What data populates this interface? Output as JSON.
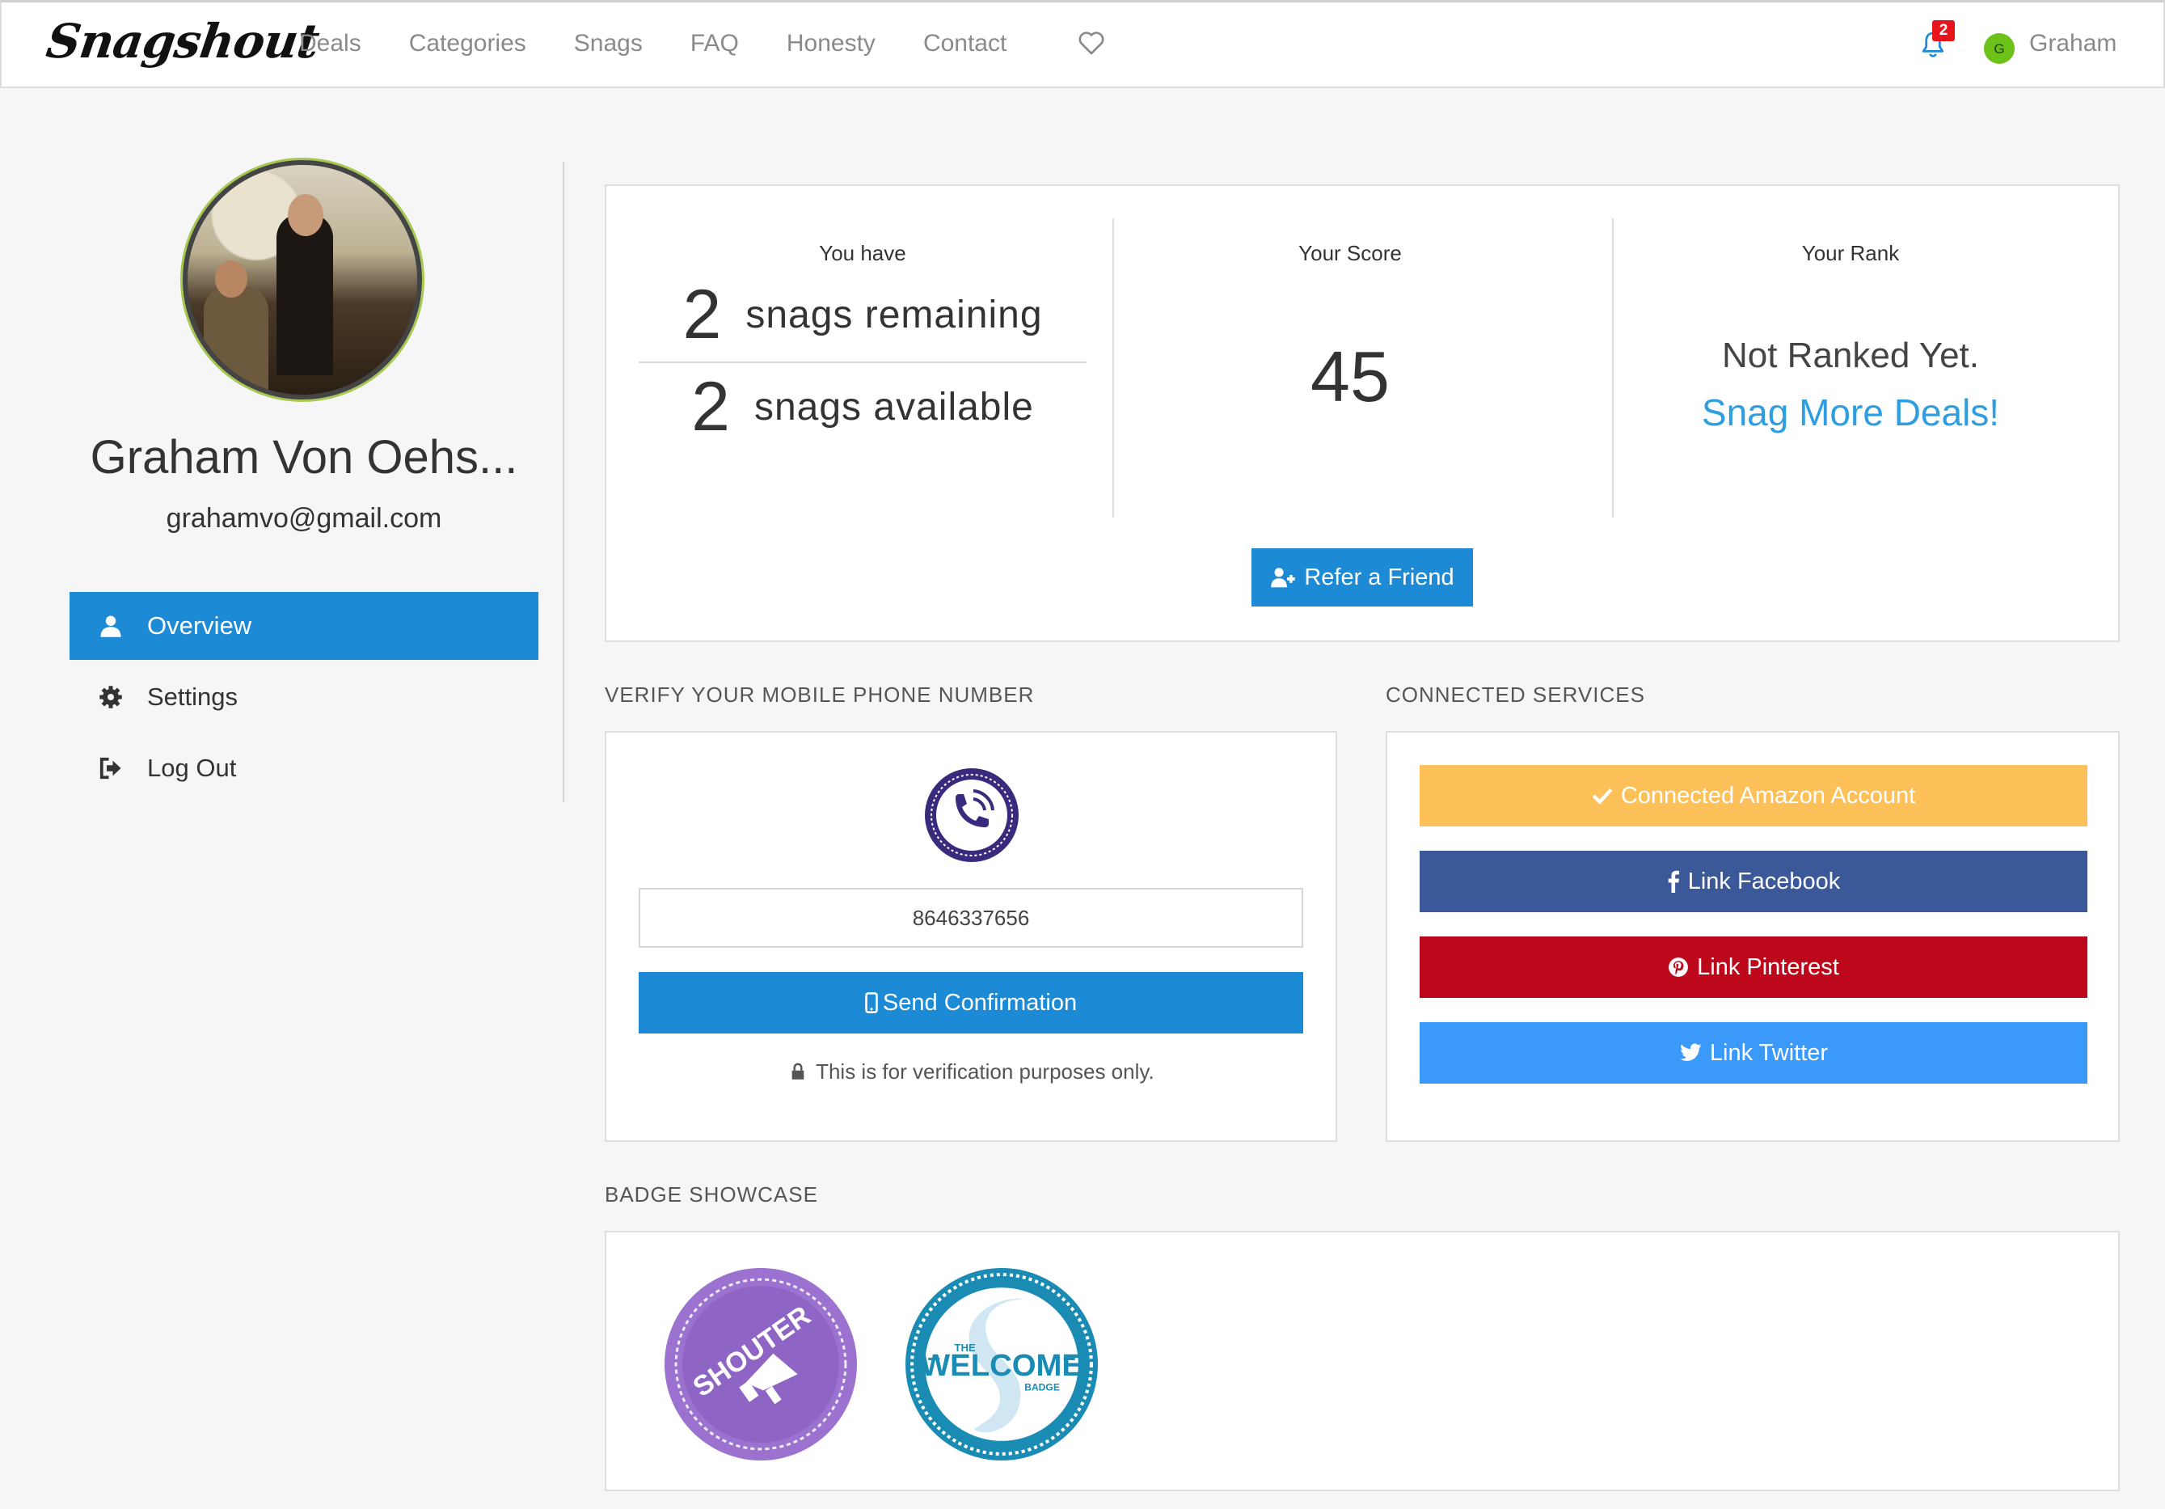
{
  "navbar": {
    "logo": "Snagshout",
    "links": [
      "Deals",
      "Categories",
      "Snags",
      "FAQ",
      "Honesty",
      "Contact"
    ],
    "notification_count": "2",
    "avatar_initial": "G",
    "user_name": "Graham"
  },
  "sidebar": {
    "name": "Graham Von Oehs...",
    "email": "grahamvo@gmail.com",
    "menu": [
      {
        "label": "Overview",
        "icon": "user-icon",
        "active": true
      },
      {
        "label": "Settings",
        "icon": "gear-icon",
        "active": false
      },
      {
        "label": "Log Out",
        "icon": "sign-out-icon",
        "active": false
      }
    ]
  },
  "stats": {
    "you_have_heading": "You have",
    "snags_remaining_value": "2",
    "snags_remaining_label": "snags remaining",
    "snags_available_value": "2",
    "snags_available_label": "snags available",
    "score_heading": "Your Score",
    "score_value": "45",
    "rank_heading": "Your Rank",
    "rank_value": "Not Ranked Yet.",
    "rank_link": "Snag More Deals!",
    "refer_button": "Refer a Friend"
  },
  "verify": {
    "section_title": "VERIFY YOUR MOBILE PHONE NUMBER",
    "phone_value": "8646337656",
    "send_button": "Send Confirmation",
    "note": "This is for verification purposes only."
  },
  "services": {
    "section_title": "CONNECTED SERVICES",
    "amazon": "Connected Amazon Account",
    "facebook": "Link Facebook",
    "pinterest": "Link Pinterest",
    "twitter": "Link Twitter"
  },
  "badges": {
    "section_title": "BADGE SHOWCASE",
    "shouter_text": "SHOUTER",
    "welcome_top": "THE",
    "welcome_main": "WELCOME",
    "welcome_bottom": "BADGE"
  },
  "colors": {
    "primary": "#1d8ad6",
    "link": "#2e9ee0",
    "amazon": "#fec058",
    "facebook": "#3b5999",
    "pinterest": "#bd081c",
    "twitter": "#3a99f9",
    "badge_purple": "#9b72cf",
    "badge_teal": "#1a8bb3"
  }
}
